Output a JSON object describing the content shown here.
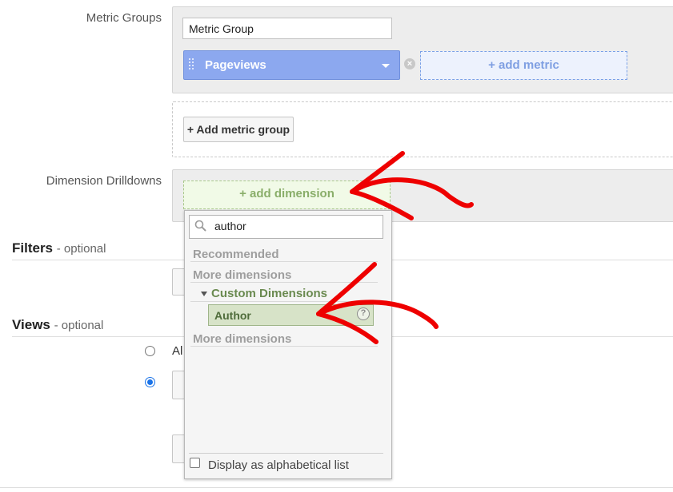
{
  "metric_groups": {
    "label": "Metric Groups",
    "group_name_value": "Metric Group",
    "metric_pill_label": "Pageviews",
    "add_metric_label": "+ add metric",
    "add_group_label": "+ Add metric group"
  },
  "dimension_drilldowns": {
    "label": "Dimension Drilldowns",
    "add_dimension_label": "+ add dimension"
  },
  "filters": {
    "title": "Filters",
    "optional": "- optional"
  },
  "views": {
    "title": "Views",
    "optional": "- optional",
    "option_all_partial": "Al"
  },
  "dropdown": {
    "search_value": "author",
    "recommended_label": "Recommended",
    "more_dimensions_label": "More dimensions",
    "custom_dimensions_label": "Custom Dimensions",
    "author_item_label": "Author",
    "help_glyph": "?",
    "more_dimensions_label_2": "More dimensions",
    "alphabetical_label": "Display as alphabetical list"
  },
  "colors": {
    "metric_pill": "#8ca8ef",
    "dimension_add": "#f1fae7",
    "annotation_arrow": "#ee0000",
    "radio_selected": "#1a73e8"
  }
}
